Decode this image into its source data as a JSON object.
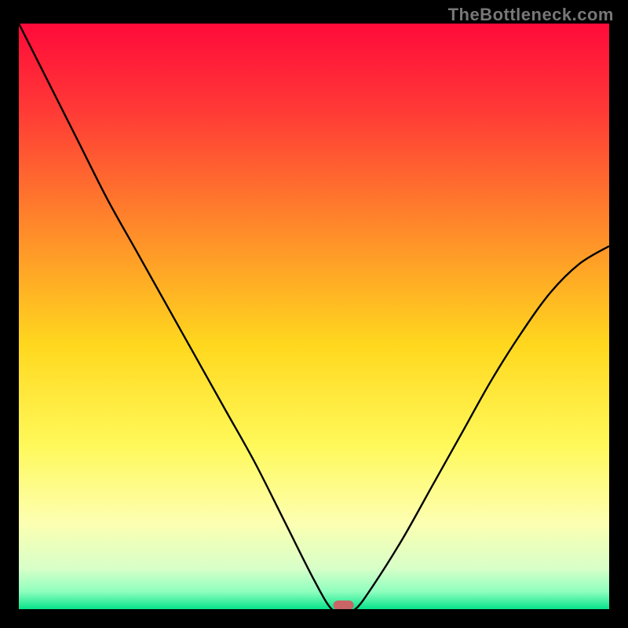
{
  "watermark": "TheBottleneck.com",
  "chart_data": {
    "type": "line",
    "title": "",
    "xlabel": "",
    "ylabel": "",
    "xlim": [
      0,
      100
    ],
    "ylim": [
      0,
      100
    ],
    "series": [
      {
        "name": "bottleneck-curve",
        "x": [
          0,
          5,
          10,
          15,
          20,
          25,
          30,
          35,
          40,
          45,
          50,
          53,
          55,
          57,
          60,
          65,
          70,
          75,
          80,
          85,
          90,
          95,
          100
        ],
        "y": [
          100,
          90,
          80,
          70,
          61,
          52,
          43,
          34,
          25,
          15,
          5,
          0,
          0,
          0,
          4,
          12,
          21,
          30,
          39,
          47,
          54,
          59,
          62
        ]
      }
    ],
    "marker": {
      "x": 55,
      "y": 0,
      "color": "#c96565"
    },
    "background_gradient": {
      "stops": [
        {
          "offset": 0.0,
          "color": "#ff0a3a"
        },
        {
          "offset": 0.15,
          "color": "#ff3a36"
        },
        {
          "offset": 0.35,
          "color": "#ff8a2a"
        },
        {
          "offset": 0.55,
          "color": "#ffd81e"
        },
        {
          "offset": 0.72,
          "color": "#fff95a"
        },
        {
          "offset": 0.85,
          "color": "#fdffb0"
        },
        {
          "offset": 0.93,
          "color": "#d8ffc8"
        },
        {
          "offset": 0.97,
          "color": "#8fffbf"
        },
        {
          "offset": 1.0,
          "color": "#07e38a"
        }
      ]
    }
  }
}
